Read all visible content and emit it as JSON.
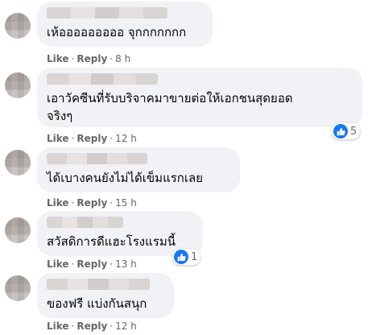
{
  "theme": {
    "like_blue": "#1877f2",
    "bubble_bg": "#f0f2f5",
    "meta_gray": "#65676b"
  },
  "actions": {
    "like_label": "Like",
    "reply_label": "Reply",
    "separator": "·"
  },
  "comments": [
    {
      "text": "เห้อออออออออ จุกกกกกกก",
      "time": "8 h",
      "reactions": null,
      "avatar_icon": "blurred-avatar"
    },
    {
      "text": "เอาวัคซีนที่รับบริจาคมาขายต่อให้เอกชนสุดยอด\nจริงๆ",
      "time": "12 h",
      "reactions": "5",
      "avatar_icon": "blurred-avatar"
    },
    {
      "text": "ได้เบางคนยังไม่ได้เข็มแรกเลย",
      "time": "15 h",
      "reactions": null,
      "avatar_icon": "blurred-avatar"
    },
    {
      "text": "สวัสดิการดีแฮะโรงแรมนี้",
      "time": "13 h",
      "reactions": "1",
      "avatar_icon": "blurred-avatar"
    },
    {
      "text": "ของฟรี แบ่งกันสนุก",
      "time": "12 h",
      "reactions": null,
      "avatar_icon": "blurred-avatar"
    }
  ]
}
